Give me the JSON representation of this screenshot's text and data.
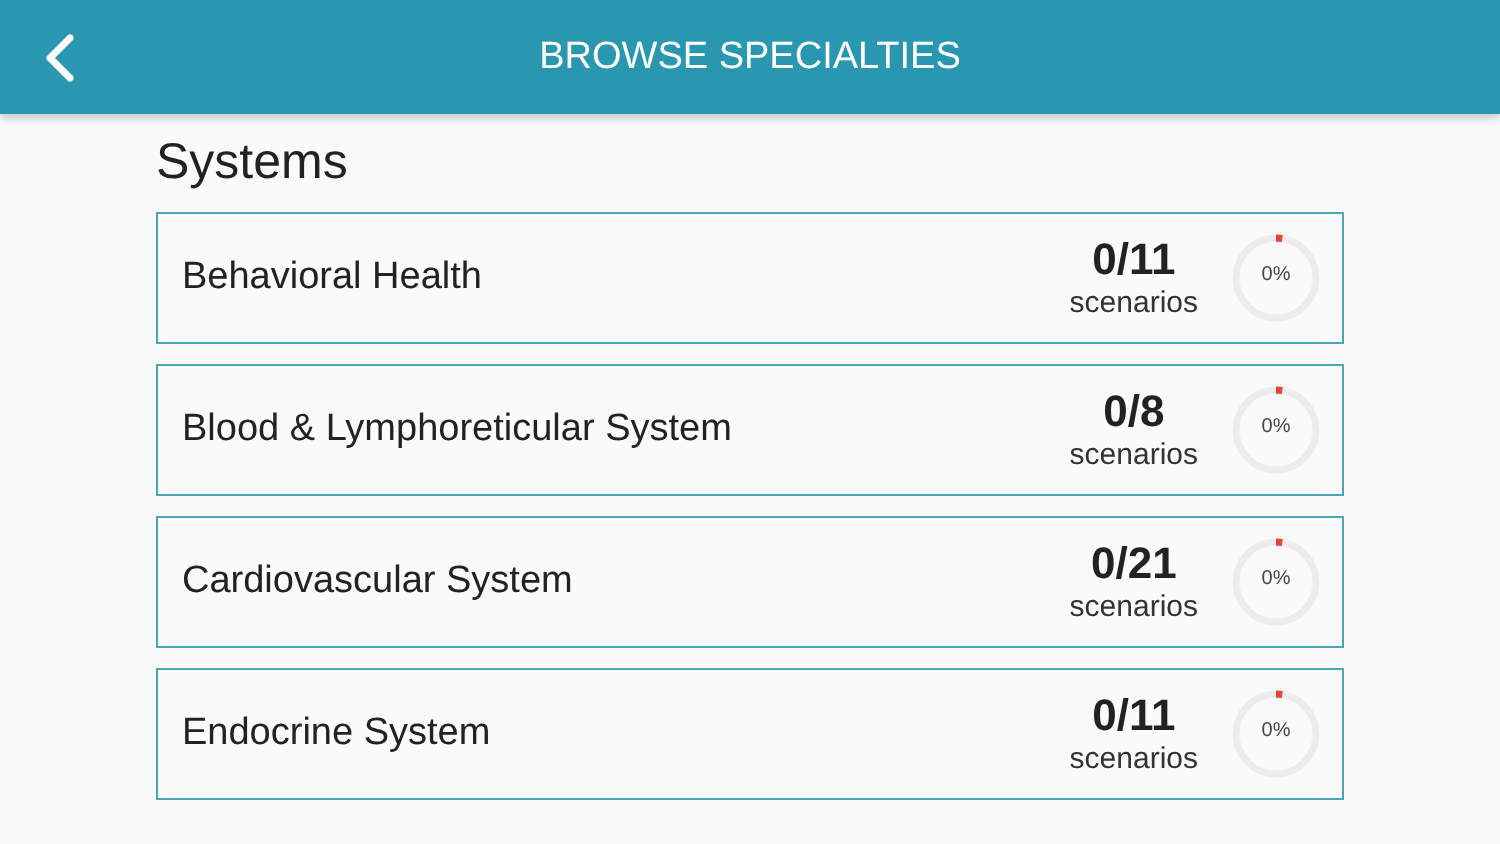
{
  "header": {
    "title": "BROWSE SPECIALTIES"
  },
  "section_title": "Systems",
  "specialties": [
    {
      "name": "Behavioral Health",
      "count": "0/11",
      "unit": "scenarios",
      "percent": "0%"
    },
    {
      "name": "Blood & Lymphoreticular System",
      "count": "0/8",
      "unit": "scenarios",
      "percent": "0%"
    },
    {
      "name": "Cardiovascular System",
      "count": "0/21",
      "unit": "scenarios",
      "percent": "0%"
    },
    {
      "name": "Endocrine System",
      "count": "0/11",
      "unit": "scenarios",
      "percent": "0%"
    }
  ]
}
